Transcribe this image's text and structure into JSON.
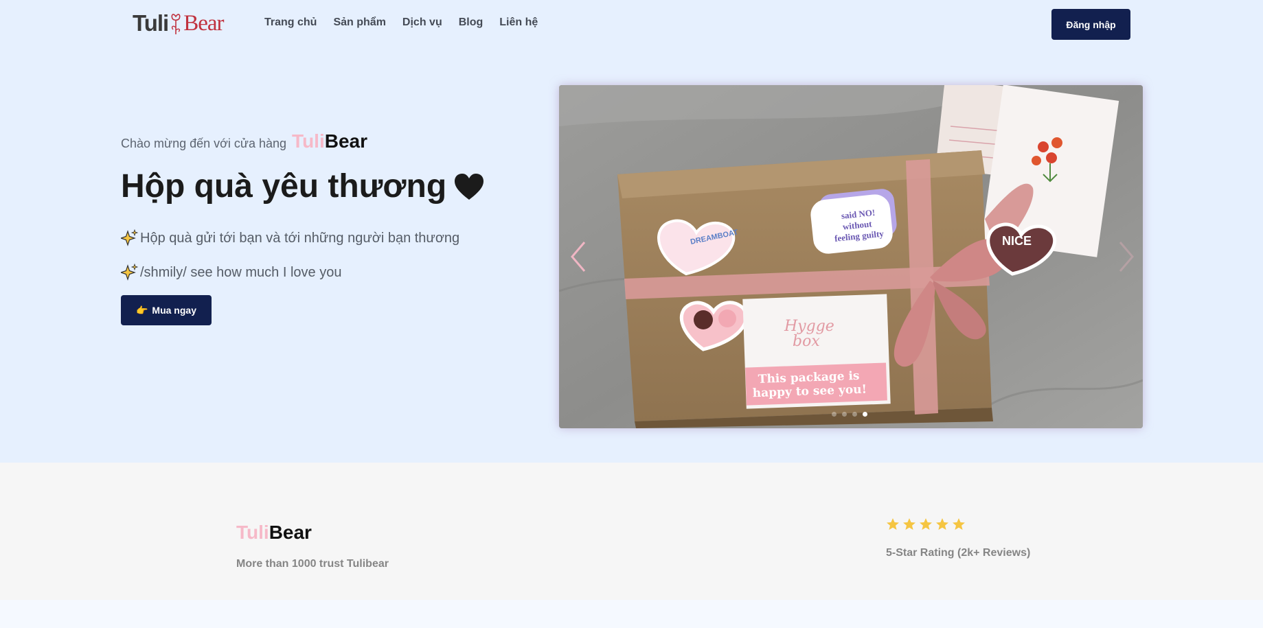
{
  "nav": {
    "logo_left": "Tuli",
    "logo_right": "Bear",
    "links": [
      "Trang chủ",
      "Sản phẩm",
      "Dịch vụ",
      "Blog",
      "Liên hệ"
    ],
    "login_label": "Đăng nhập"
  },
  "hero": {
    "welcome": "Chào mừng đến với cửa hàng",
    "brand_pink": "Tuli",
    "brand_dark": "Bear",
    "title": "Hộp quà yêu thương",
    "line1": "Hộp quà gửi tới bạn và tới những người bạn thương",
    "line2": "/shmily/ see how much I love you",
    "buy_label": "Mua ngay",
    "buy_icon": "👉"
  },
  "carousel": {
    "slide_count": 4,
    "active_index": 3,
    "stickers": {
      "speech": [
        "said NO!",
        "without",
        "feeling guilty"
      ],
      "heart_left": "DREAMBOAT",
      "heart_right": "NICE",
      "label_script": [
        "Hygge",
        "box"
      ],
      "label_banner": [
        "This package is",
        "happy to see you!"
      ]
    }
  },
  "stats": {
    "brand_pink": "Tuli",
    "brand_dark": "Bear",
    "trust": "More than 1000 trust Tulibear",
    "stars": 5,
    "rating": "5-Star Rating (2k+ Reviews)"
  },
  "colors": {
    "navy": "#12204f",
    "pink": "#f6b9c8",
    "star": "#f5c542",
    "hero_bg": "#e6f0fe"
  }
}
